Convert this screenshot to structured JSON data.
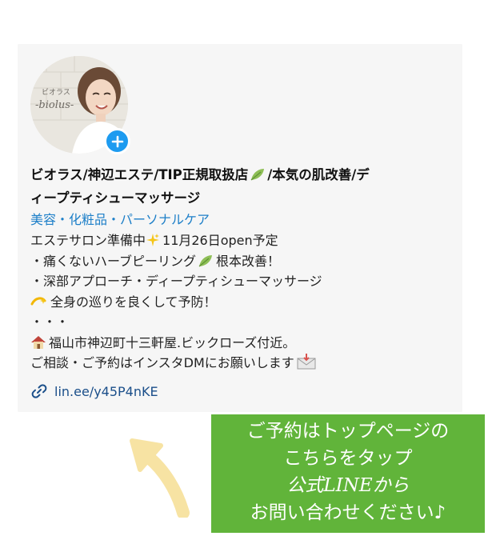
{
  "profile": {
    "avatar_text_top": "ビオラス",
    "avatar_text_script": "-biolus-",
    "name_line1": "ビオラス/神辺エステ/TIP正規取扱店",
    "name_line1_tail": "/本気の肌改善/デ",
    "name_line2": "ィープティシューマッサージ",
    "category": "美容・化粧品・パーソナルケア"
  },
  "bio": {
    "line1_prefix": "エステサロン準備中",
    "line1_suffix": "11月26日open予定",
    "line2_prefix": "・痛くないハーブピーリング",
    "line2_suffix": "根本改善！",
    "line3": "・深部アプローチ・ディープティシューマッサージ",
    "line4": "全身の巡りを良くして予防！",
    "line5": "・・・",
    "line6": "福山市神辺町十三軒屋.ビックローズ付近。",
    "line7": "ご相談・ご予約はインスタDMにお願いします"
  },
  "link": {
    "url": "lin.ee/y45P4nKE"
  },
  "cta": {
    "line1": "ご予約はトップページの",
    "line2": "こちらをタップ",
    "line3": "公式LINEから",
    "line4": "お問い合わせください♪"
  },
  "colors": {
    "category_blue": "#1d7fc8",
    "badge_blue": "#1d9bf0",
    "cta_green": "#61b43a",
    "arrow_yellow": "#f7e3a3",
    "link_blue": "#1b4f8a"
  },
  "icons": {
    "add": "plus-icon",
    "link": "link-icon",
    "leaf": "leaf-icon",
    "sparkles": "sparkles-icon",
    "dizzy": "dizzy-icon",
    "house": "house-icon",
    "envelope": "envelope-icon",
    "arrow": "arrow-up-icon"
  }
}
